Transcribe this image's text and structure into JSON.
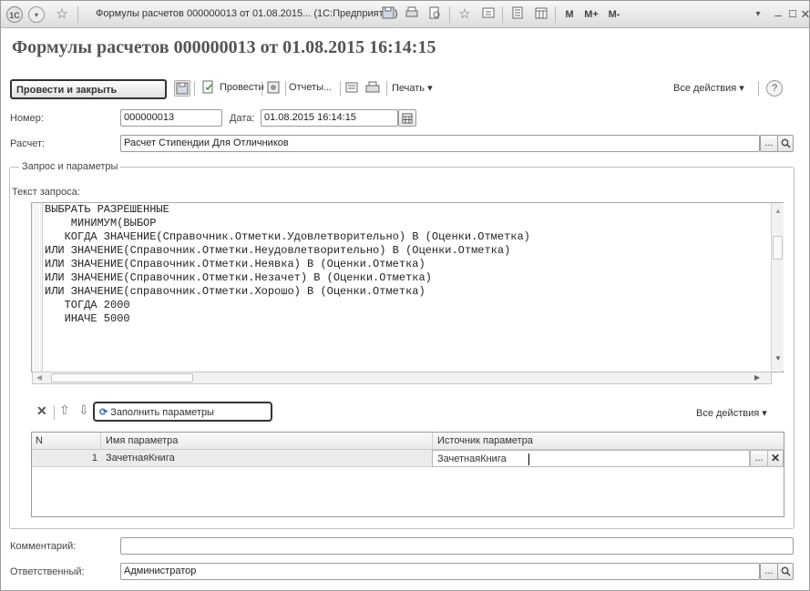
{
  "window": {
    "logo": "1С",
    "title": "Формулы расчетов 000000013 от 01.08.2015... (1С:Предприятие)",
    "buttons": [
      "M",
      "M+",
      "M-"
    ]
  },
  "heading": "Формулы расчетов 000000013 от 01.08.2015 16:14:15",
  "toolbar": {
    "post_close": "Провести и закрыть",
    "post": "Провести",
    "reports": "Отчеты...",
    "print": "Печать",
    "all_actions": "Все действия"
  },
  "form": {
    "number_label": "Номер:",
    "number_value": "000000013",
    "date_label": "Дата:",
    "date_value": "01.08.2015 16:14:15",
    "calc_label": "Расчет:",
    "calc_value": "Расчет Стипендии Для Отличников",
    "comment_label": "Комментарий:",
    "comment_value": "",
    "responsible_label": "Ответственный:",
    "responsible_value": "Администратор"
  },
  "group": {
    "title": "Запрос и параметры",
    "query_label": "Текст запроса:",
    "query_text": "ВЫБРАТЬ РАЗРЕШЕННЫЕ\n    МИНИМУМ(ВЫБОР\n   КОГДА ЗНАЧЕНИЕ(Справочник.Отметки.Удовлетворительно) В (Оценки.Отметка)\nИЛИ ЗНАЧЕНИЕ(Справочник.Отметки.Неудовлетворительно) В (Оценки.Отметка)\nИЛИ ЗНАЧЕНИЕ(Справочник.Отметки.Неявка) В (Оценки.Отметка)\nИЛИ ЗНАЧЕНИЕ(Справочник.Отметки.Незачет) В (Оценки.Отметка)\nИЛИ ЗНАЧЕНИЕ(справочник.Отметки.Хорошо) В (Оценки.Отметка)\n   ТОГДА 2000\n   ИНАЧЕ 5000",
    "fill_params": "Заполнить параметры",
    "all_actions": "Все действия"
  },
  "params_table": {
    "columns": [
      "N",
      "Имя параметра",
      "Источник параметра"
    ],
    "rows": [
      {
        "n": "1",
        "name": "ЗачетнаяКнига",
        "source": "ЗачетнаяКнига"
      }
    ]
  },
  "icons": {
    "ellipsis": "...",
    "delete": "✕",
    "up": "⇧",
    "down": "⇩"
  }
}
